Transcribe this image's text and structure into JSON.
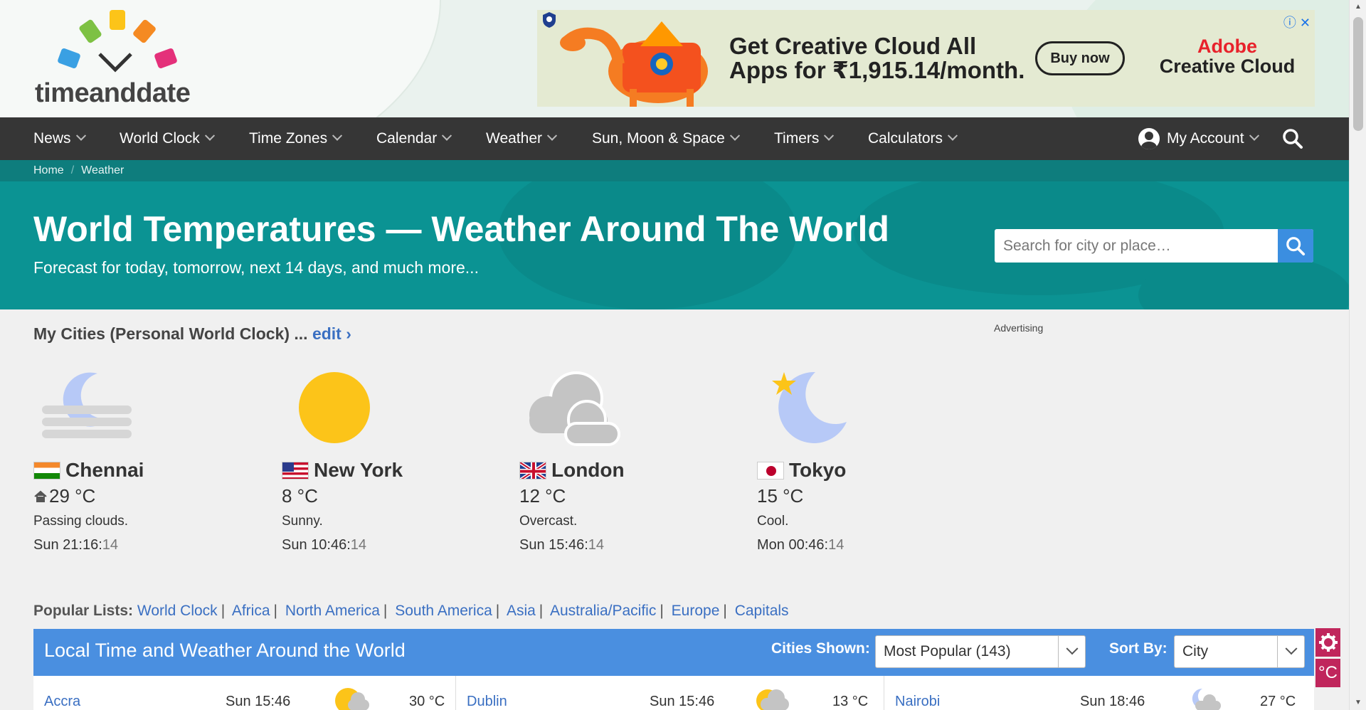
{
  "logo": {
    "text": "timeanddate"
  },
  "ad": {
    "headline": "Get Creative Cloud All Apps for ₹1,915.14/month.",
    "button": "Buy now",
    "brand_line1": "Adobe",
    "brand_line2": "Creative Cloud"
  },
  "nav": {
    "items": [
      {
        "label": "News"
      },
      {
        "label": "World Clock"
      },
      {
        "label": "Time Zones"
      },
      {
        "label": "Calendar"
      },
      {
        "label": "Weather"
      },
      {
        "label": "Sun, Moon & Space"
      },
      {
        "label": "Timers"
      },
      {
        "label": "Calculators"
      }
    ],
    "account": "My Account"
  },
  "breadcrumb": {
    "home": "Home",
    "current": "Weather"
  },
  "hero": {
    "title": "World Temperatures — Weather Around The World",
    "subtitle": "Forecast for today, tomorrow, next 14 days, and much more...",
    "search_placeholder": "Search for city or place…"
  },
  "my_cities": {
    "title": "My Cities (Personal World Clock) ...",
    "edit": "edit ›",
    "advertising": "Advertising",
    "cities": [
      {
        "name": "Chennai",
        "temp": "29 °C",
        "desc": "Passing clouds.",
        "time": "Sun 21:16:",
        "sec": "14",
        "icon": "night-fog-icon",
        "home": true
      },
      {
        "name": "New York",
        "temp": "8 °C",
        "desc": "Sunny.",
        "time": "Sun 10:46:",
        "sec": "14",
        "icon": "sun-icon"
      },
      {
        "name": "London",
        "temp": "12 °C",
        "desc": "Overcast.",
        "time": "Sun 15:46:",
        "sec": "14",
        "icon": "overcast-icon"
      },
      {
        "name": "Tokyo",
        "temp": "15 °C",
        "desc": "Cool.",
        "time": "Mon 00:46:",
        "sec": "14",
        "icon": "moon-star-icon"
      }
    ]
  },
  "popular": {
    "label": "Popular Lists:",
    "links": [
      "World Clock",
      "Africa",
      "North America",
      "South America",
      "Asia",
      "Australia/Pacific",
      "Europe",
      "Capitals"
    ]
  },
  "table": {
    "title": "Local Time and Weather Around the World",
    "cities_shown_label": "Cities Shown:",
    "cities_shown_value": "Most Popular (143)",
    "sort_by_label": "Sort By:",
    "sort_by_value": "City",
    "unit_button": "°C",
    "rows": [
      {
        "city": "Accra",
        "time": "Sun 15:46",
        "temp": "30 °C"
      },
      {
        "city": "Dublin",
        "time": "Sun 15:46",
        "temp": "13 °C"
      },
      {
        "city": "Nairobi",
        "time": "Sun 18:46",
        "temp": "27 °C"
      }
    ]
  },
  "colors": {
    "nav_bg": "#363636",
    "hero_bg": "#0b9393",
    "link": "#3a6fc2",
    "table_head": "#4a8fe0",
    "accent": "#c0265c"
  }
}
